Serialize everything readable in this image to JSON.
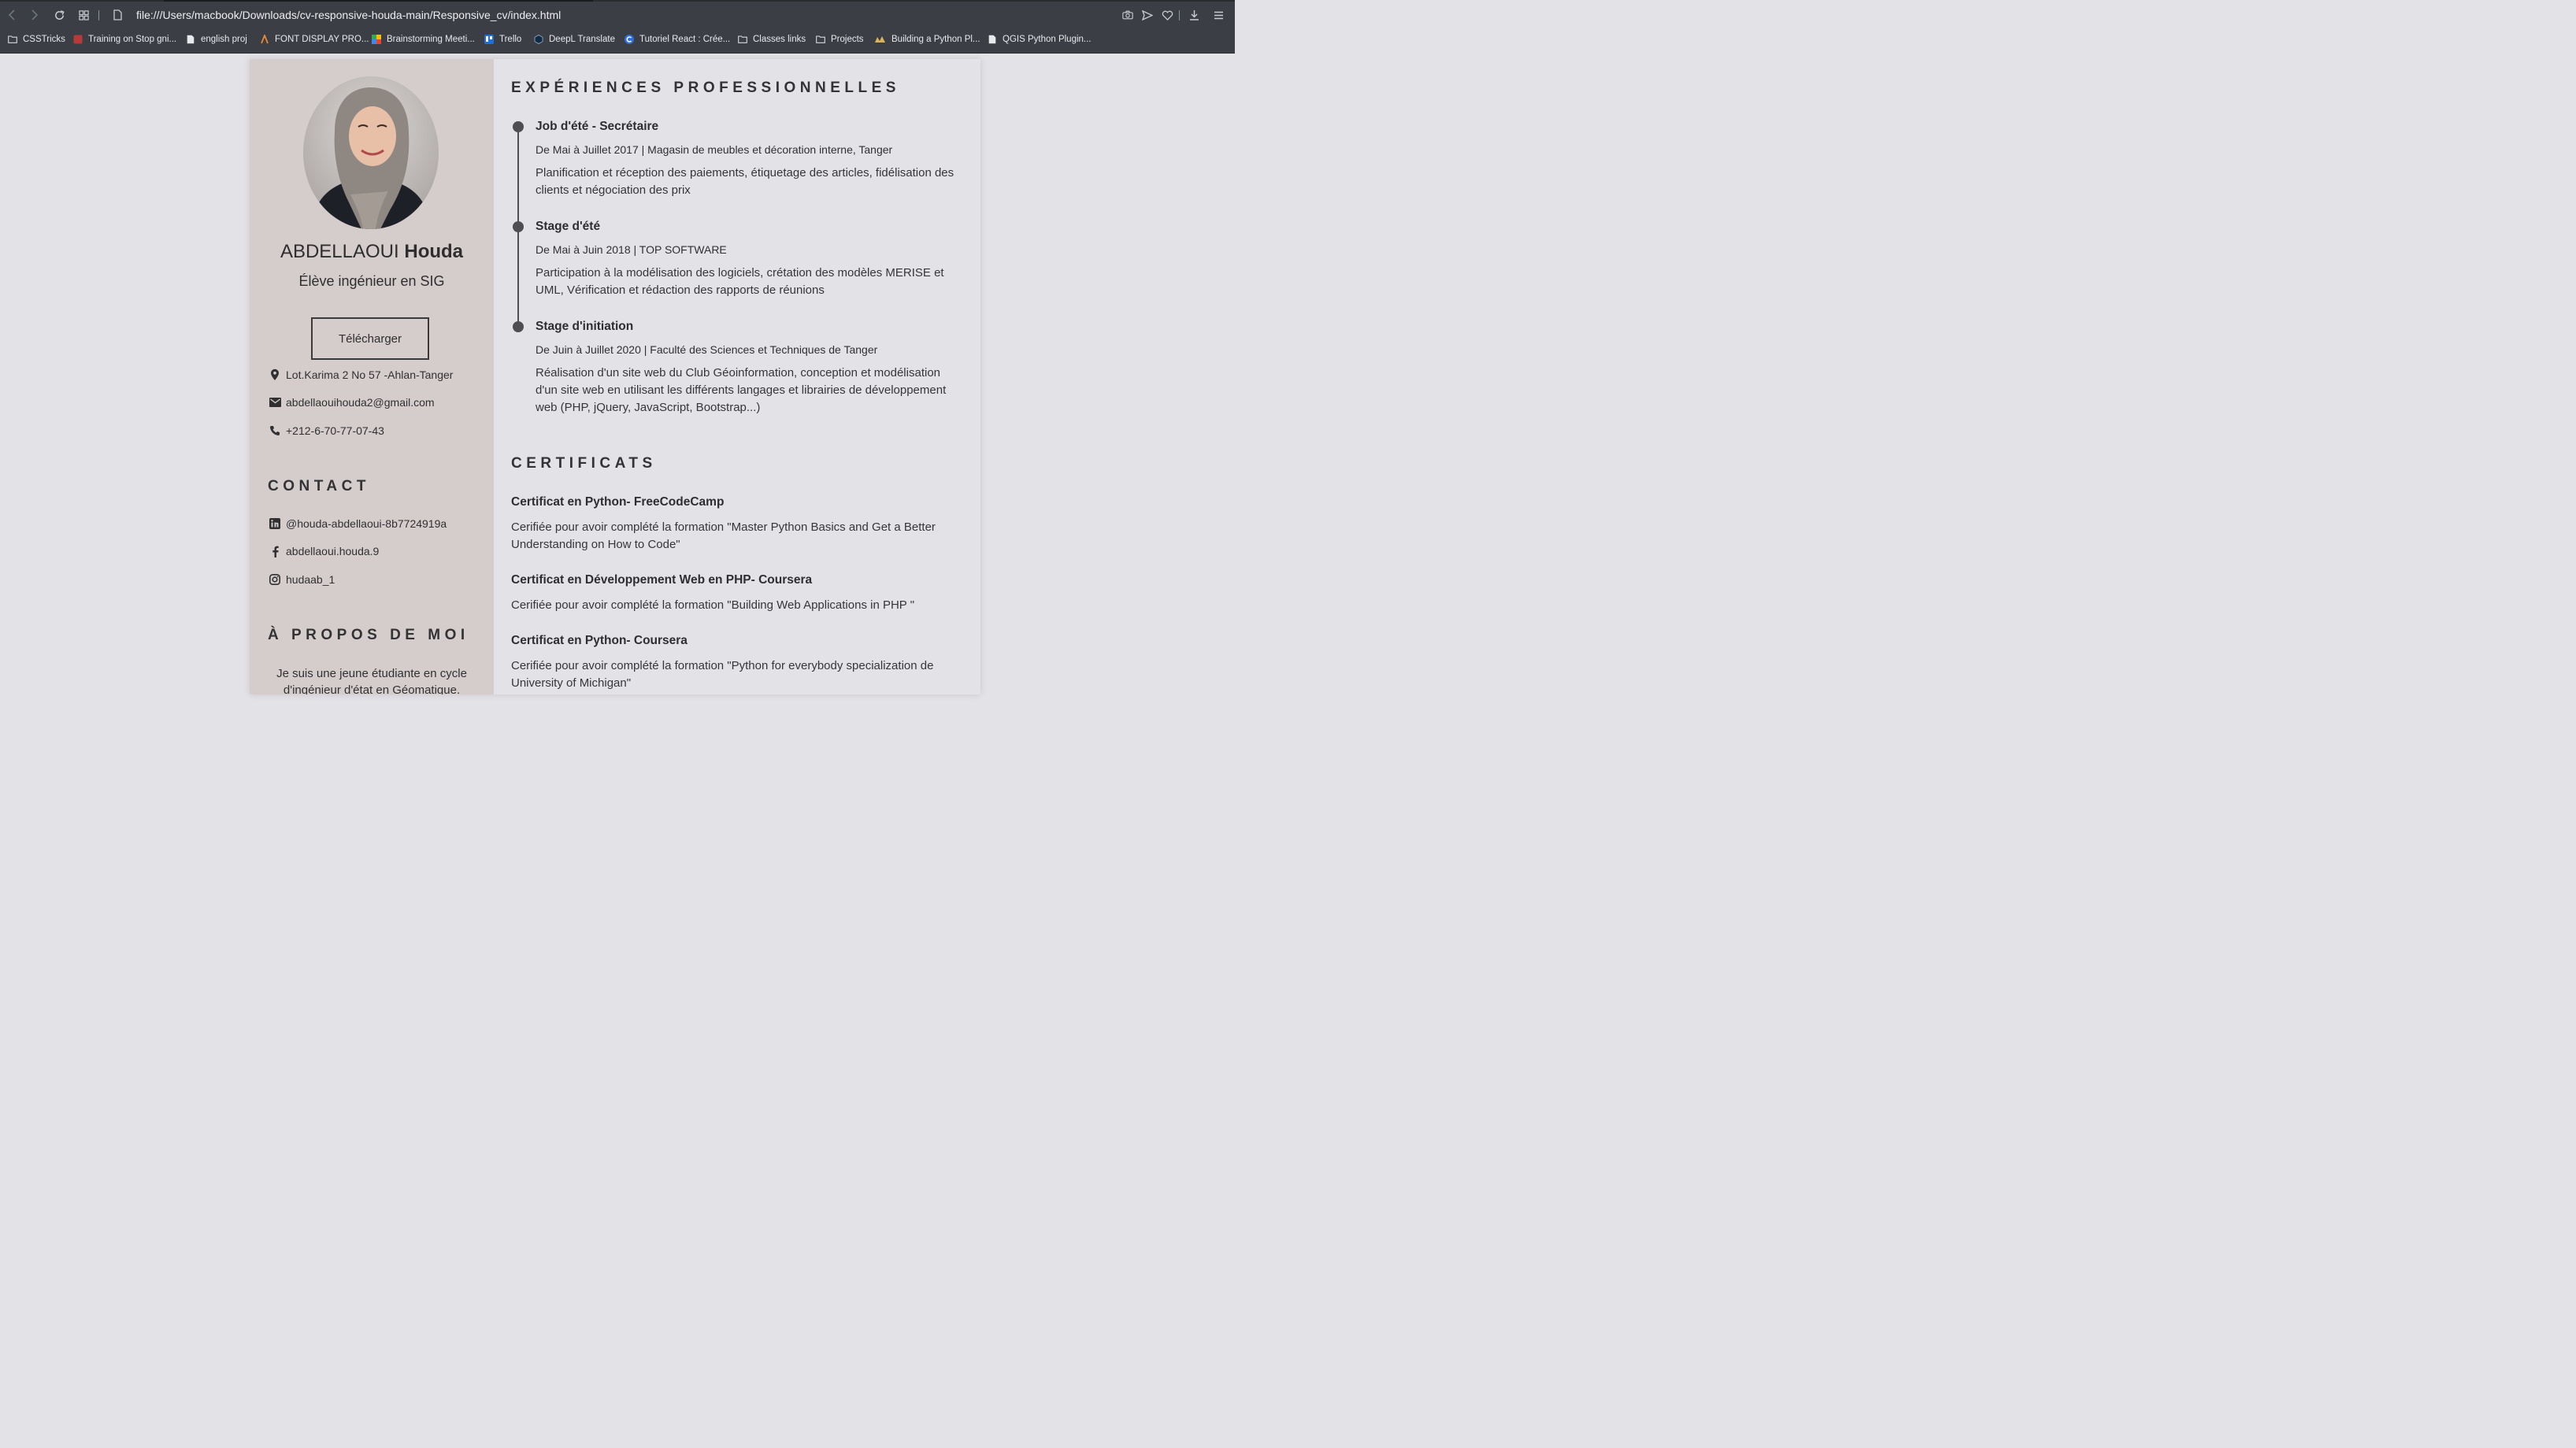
{
  "browser": {
    "url": "file:///Users/macbook/Downloads/cv-responsive-houda-main/Responsive_cv/index.html",
    "bookmarks": [
      {
        "label": "CSSTricks",
        "icon": "folder-icon"
      },
      {
        "label": "Training on Stop gni...",
        "icon": "site-favicon-icon"
      },
      {
        "label": "english proj",
        "icon": "document-icon"
      },
      {
        "label": "FONT DISPLAY PRO...",
        "icon": "site-favicon-icon"
      },
      {
        "label": "Brainstorming Meeti...",
        "icon": "site-favicon-icon"
      },
      {
        "label": "Trello",
        "icon": "trello-icon"
      },
      {
        "label": "DeepL Translate",
        "icon": "deepl-icon"
      },
      {
        "label": "Tutoriel React : Crée...",
        "icon": "site-favicon-icon"
      },
      {
        "label": "Classes links",
        "icon": "folder-icon"
      },
      {
        "label": "Projects",
        "icon": "folder-icon"
      },
      {
        "label": "Building a Python Pl...",
        "icon": "site-favicon-icon"
      },
      {
        "label": "QGIS Python Plugin...",
        "icon": "document-icon"
      }
    ]
  },
  "profile": {
    "last_name": "ABDELLAOUI",
    "first_name": "Houda",
    "role": "Élève ingénieur en SIG",
    "download_label": "Télécharger",
    "address": "Lot.Karima 2 No 57 -Ahlan-Tanger",
    "email": "abdellaouihouda2@gmail.com",
    "phone": "+212-6-70-77-07-43"
  },
  "contact": {
    "title": "CONTACT",
    "linkedin": "@houda-abdellaoui-8b7724919a",
    "facebook": "abdellaoui.houda.9",
    "instagram": "hudaab_1"
  },
  "about": {
    "title": "À PROPOS DE MOI",
    "text": "Je suis une jeune étudiante en cycle d'ingénieur d'état en Géomatique."
  },
  "experience": {
    "title": "EXPÉRIENCES PROFESSIONNELLES",
    "items": [
      {
        "title": "Job d'été - Secrétaire",
        "meta": "De Mai à Juillet 2017 | Magasin de meubles et décoration interne, Tanger",
        "desc": "Planification et réception des paiements, étiquetage des articles, fidélisation des clients et négociation des prix"
      },
      {
        "title": "Stage d'été",
        "meta": "De Mai à Juin 2018 | TOP SOFTWARE",
        "desc": "Participation à la modélisation des logiciels, crétation des modèles MERISE et UML, Vérification et rédaction des rapports de réunions"
      },
      {
        "title": "Stage d'initiation",
        "meta": "De Juin à Juillet 2020 | Faculté des Sciences et Techniques de Tanger",
        "desc": "Réalisation d'un site web du Club Géoinformation, conception et modélisation d'un site web en utilisant les différents langages et librairies de développement web (PHP, jQuery, JavaScript, Bootstrap...)"
      }
    ]
  },
  "certificates": {
    "title": "CERTIFICATS",
    "items": [
      {
        "title": "Certificat en Python- FreeCodeCamp",
        "desc": "Cerifiée pour avoir complété la formation \"Master Python Basics and Get a Better Understanding on How to Code\""
      },
      {
        "title": "Certificat en Développement Web en PHP- Coursera",
        "desc": "Cerifiée pour avoir complété la formation \"Building Web Applications in PHP \""
      },
      {
        "title": "Certificat en Python- Coursera",
        "desc": "Cerifiée pour avoir complété la formation \"Python for everybody specialization de University of Michigan\""
      }
    ]
  },
  "colors": {
    "sidebar_bg": "#d5cdcc",
    "main_bg": "#e3e2e6",
    "chrome_bg": "#3b3e44",
    "text_dark": "#2e2e30",
    "timeline": "#4e4e50"
  }
}
